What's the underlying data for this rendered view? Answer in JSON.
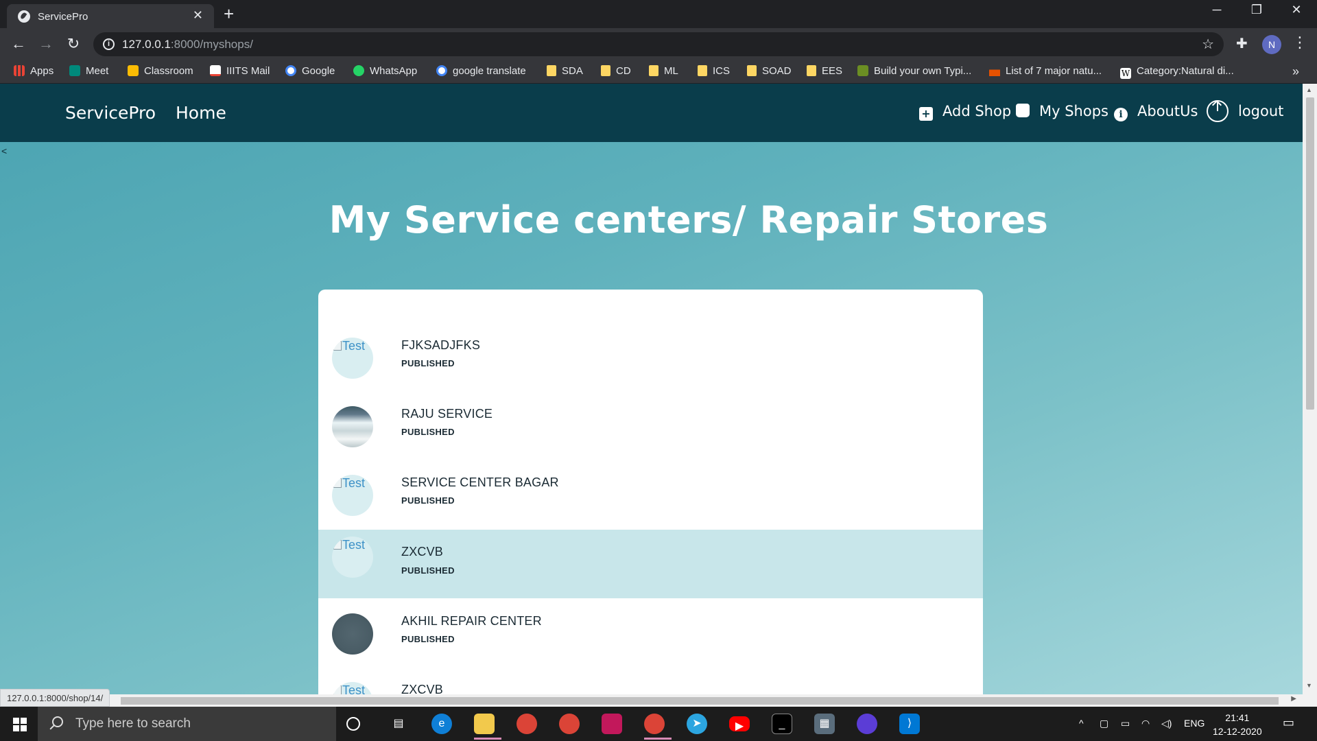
{
  "browser": {
    "tab_title": "ServicePro",
    "tab_close": "✕",
    "new_tab": "+",
    "url_host": "127.0.0.1",
    "url_rest": ":8000/myshops/",
    "profile_initial": "N",
    "bookmarks": [
      {
        "label": "Apps",
        "icon": "apps-grid-icon",
        "color": "#ea4335"
      },
      {
        "label": "Meet",
        "icon": "meet-icon",
        "color": "#00897b"
      },
      {
        "label": "Classroom",
        "icon": "classroom-icon",
        "color": "#fbbc04"
      },
      {
        "label": "IIITS Mail",
        "icon": "gmail-icon",
        "color": "#ea4335"
      },
      {
        "label": "Google",
        "icon": "google-icon",
        "color": "#4285f4"
      },
      {
        "label": "WhatsApp",
        "icon": "whatsapp-icon",
        "color": "#25d366"
      },
      {
        "label": "google translate",
        "icon": "google-icon",
        "color": "#4285f4"
      },
      {
        "label": "SDA",
        "icon": "folder-icon"
      },
      {
        "label": "CD",
        "icon": "folder-icon"
      },
      {
        "label": "ML",
        "icon": "folder-icon"
      },
      {
        "label": "ICS",
        "icon": "folder-icon"
      },
      {
        "label": "SOAD",
        "icon": "folder-icon"
      },
      {
        "label": "EES",
        "icon": "folder-icon"
      },
      {
        "label": "Build your own Typi...",
        "icon": "typing-site-icon",
        "color": "#6b8e23"
      },
      {
        "label": "List of 7 major natu...",
        "icon": "news-site-icon",
        "color": "#e65100"
      },
      {
        "label": "Category:Natural di...",
        "icon": "wikipedia-icon",
        "color": "#ffffff"
      }
    ],
    "bookmarks_more": "»",
    "status_url": "127.0.0.1:8000/shop/14/"
  },
  "navbar": {
    "brand": "ServicePro",
    "home": "Home",
    "add_shop": "Add Shop",
    "my_shops": "My Shops",
    "about": "AboutUs",
    "logout": "logout"
  },
  "stray_text": "<",
  "main": {
    "title": "My Service centers/ Repair Stores",
    "avatar_alt": "Test",
    "shops": [
      {
        "name": "FJKSADJFKS",
        "status": "PUBLISHED"
      },
      {
        "name": "RAJU SERVICE",
        "status": "PUBLISHED"
      },
      {
        "name": "SERVICE CENTER BAGAR",
        "status": "PUBLISHED"
      },
      {
        "name": "ZXCVB",
        "status": "PUBLISHED"
      },
      {
        "name": "AKHIL REPAIR CENTER",
        "status": "PUBLISHED"
      },
      {
        "name": "ZXCVB",
        "status": ""
      }
    ]
  },
  "taskbar": {
    "search_placeholder": "Type here to search",
    "language": "ENG",
    "time": "21:41",
    "date": "12-12-2020"
  },
  "colors": {
    "navbar": "#0a3d4b",
    "active_row": "#c8e6ea",
    "background_gradient_start": "#4aa3b1",
    "background_gradient_end": "#a6d7dc"
  }
}
